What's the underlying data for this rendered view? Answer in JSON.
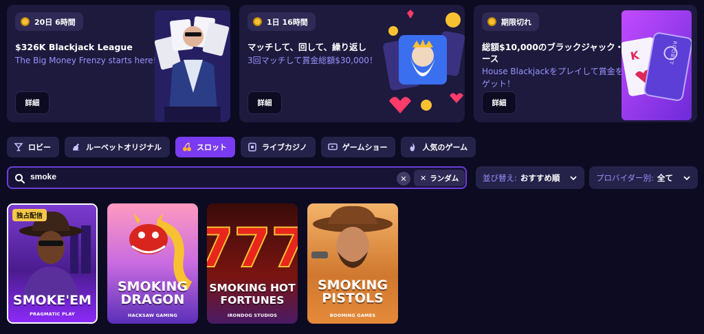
{
  "promos": [
    {
      "timer": "20日 6時間",
      "title": "$326K Blackjack League",
      "subtitle": [
        "The Big Money Frenzy starts here!"
      ],
      "button": "詳細"
    },
    {
      "timer": "1日 16時間",
      "title": "マッチして、回して、繰り返し",
      "subtitle": [
        "3回マッチして賞金総額$30,000！"
      ],
      "button": "詳細"
    },
    {
      "timer": "期限切れ",
      "title": "総額$10,000のブラックジャック・レ",
      "title2": "ース",
      "subtitle": [
        "House Blackjackをプレイして賞金を",
        "ゲット！"
      ],
      "button": "詳細",
      "card_brand": "ROOBET"
    }
  ],
  "tabs": [
    {
      "label": "ロビー",
      "icon": "cocktail-icon",
      "active": false
    },
    {
      "label": "ルーベットオリジナル",
      "icon": "kangaroo-icon",
      "active": false
    },
    {
      "label": "スロット",
      "icon": "cherry-icon",
      "active": true
    },
    {
      "label": "ライブカジノ",
      "icon": "live-card-icon",
      "active": false
    },
    {
      "label": "ゲームショー",
      "icon": "tv-icon",
      "active": false
    },
    {
      "label": "人気のゲーム",
      "icon": "flame-icon",
      "active": false
    }
  ],
  "search": {
    "value": "smoke",
    "random_label": "ランダム"
  },
  "sort": {
    "label": "並び替え:",
    "value": "おすすめ順"
  },
  "provider": {
    "label": "プロバイダー別:",
    "value": "全て"
  },
  "games": [
    {
      "name_lines": [
        "SMOKE'EM"
      ],
      "provider": "PRAGMATIC PLAY",
      "badge": "独占配信"
    },
    {
      "name_lines": [
        "SMOKING",
        "DRAGON"
      ],
      "provider": "HACKSAW GAMING"
    },
    {
      "name_lines": [
        "SMOKING HOT",
        "FORTUNES"
      ],
      "provider": "IRONDOG STUDIOS"
    },
    {
      "name_lines": [
        "SMOKING",
        "PISTOLS"
      ],
      "provider": "BOOMING GAMES"
    }
  ],
  "colors": {
    "background": "#0d0b22",
    "card": "#1d1a3d",
    "accent": "#7a3cf2",
    "subtitle": "#9b93ff",
    "coin": "#f7c132",
    "badge": "#f5c84a"
  }
}
